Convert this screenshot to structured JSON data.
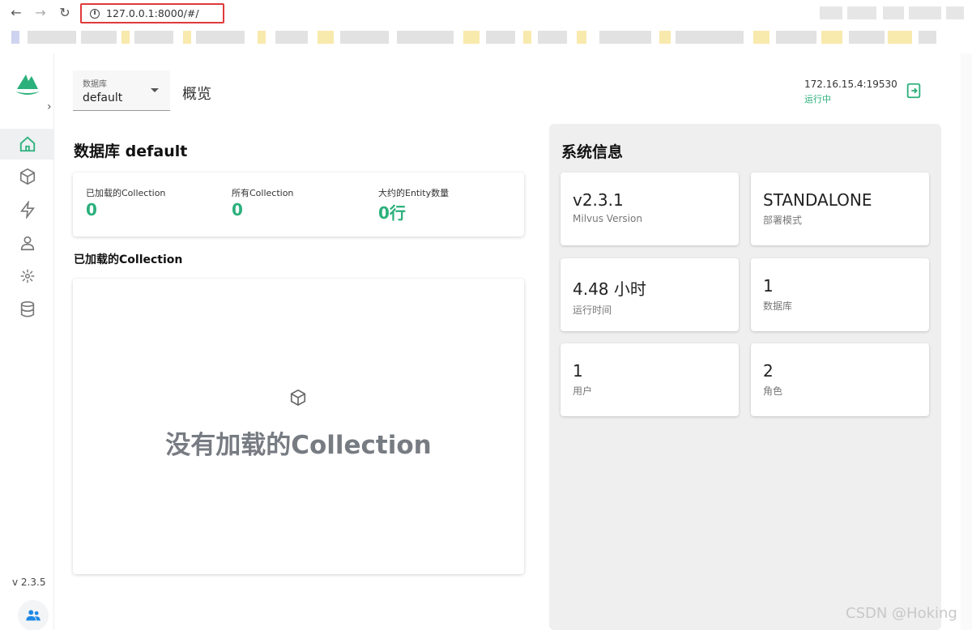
{
  "browser": {
    "url": "127.0.0.1:8000/#/",
    "back_icon": "←",
    "forward_icon": "→",
    "reload_icon": "↻"
  },
  "sidebar": {
    "version": "v 2.3.5",
    "items": [
      {
        "icon": "home-icon",
        "active": true
      },
      {
        "icon": "cube-icon",
        "active": false
      },
      {
        "icon": "lightning-icon",
        "active": false
      },
      {
        "icon": "user-icon",
        "active": false
      },
      {
        "icon": "network-icon",
        "active": false
      },
      {
        "icon": "database-icon",
        "active": false
      }
    ]
  },
  "header": {
    "db_select_label": "数据库",
    "db_select_value": "default",
    "page_title": "概览",
    "server_address": "172.16.15.4:19530",
    "server_status": "运行中"
  },
  "database": {
    "title": "数据库 default",
    "stats": [
      {
        "label": "已加载的Collection",
        "value": "0"
      },
      {
        "label": "所有Collection",
        "value": "0"
      },
      {
        "label": "大约的Entity数量",
        "value": "0行"
      }
    ],
    "loaded_title": "已加载的Collection",
    "empty_text": "没有加载的Collection"
  },
  "system": {
    "title": "系统信息",
    "cards": [
      {
        "value": "v2.3.1",
        "label": "Milvus Version"
      },
      {
        "value": "STANDALONE",
        "label": "部署模式"
      },
      {
        "value": "4.48 小时",
        "label": "运行时间"
      },
      {
        "value": "1",
        "label": "数据库"
      },
      {
        "value": "1",
        "label": "用户"
      },
      {
        "value": "2",
        "label": "角色"
      }
    ]
  },
  "watermark": "CSDN @Hoking",
  "colors": {
    "accent": "#2bb07b",
    "url_highlight": "#e03a3a"
  }
}
